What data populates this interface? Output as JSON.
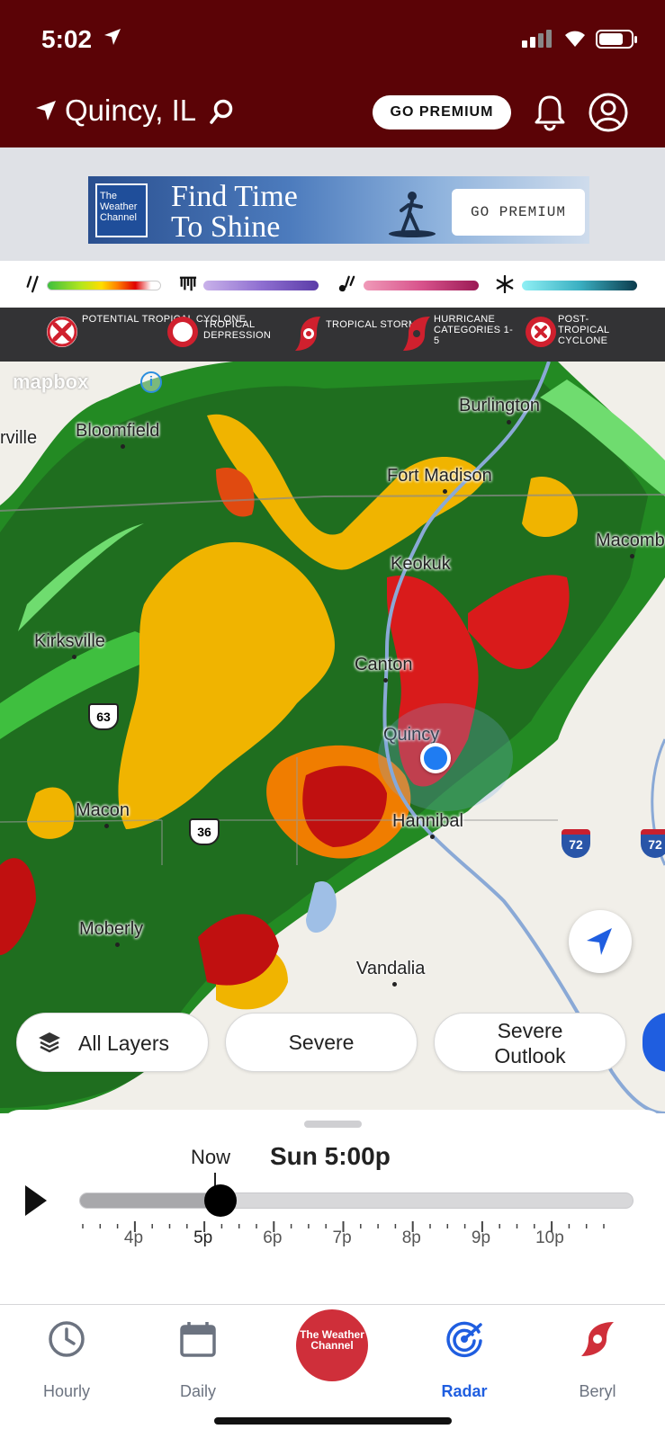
{
  "status": {
    "time": "5:02"
  },
  "header": {
    "location": "Quincy, IL",
    "premium_label": "GO PREMIUM"
  },
  "ad": {
    "logo_text": "The Weather Channel",
    "headline_line1": "Find Time",
    "headline_line2": "To Shine",
    "button_label": "GO PREMIUM"
  },
  "precip_legend": [
    {
      "type": "rain-icon",
      "colors": [
        "#3fbf3f",
        "#b5e61d",
        "#ffdd00",
        "#ff7f00",
        "#e00000",
        "#ffffff"
      ]
    },
    {
      "type": "ice-icon",
      "colors": [
        "#c9b2ea",
        "#8f6fd1",
        "#5b3ca8"
      ]
    },
    {
      "type": "mix-icon",
      "colors": [
        "#f09ab8",
        "#d8538c",
        "#9b1a55"
      ]
    },
    {
      "type": "snow-icon",
      "colors": [
        "#8ff0f5",
        "#3bb0c2",
        "#0b3b4c"
      ]
    }
  ],
  "storm_legend": [
    {
      "icon": "x-circle-icon",
      "label": "POTENTIAL TROPICAL CYCLONE"
    },
    {
      "icon": "ring-icon",
      "label": "TROPICAL DEPRESSION"
    },
    {
      "icon": "tropical-storm-icon",
      "label": "TROPICAL STORM"
    },
    {
      "icon": "hurricane-icon",
      "label": "HURRICANE CATEGORIES 1-5"
    },
    {
      "icon": "x-circle-icon",
      "label": "POST-TROPICAL CYCLONE"
    }
  ],
  "map": {
    "attribution": "mapbox",
    "cities": {
      "burlington": "Burlington",
      "bloomfield": "Bloomfield",
      "rville": "rville",
      "fort_madison": "Fort Madison",
      "macomb": "Macomb",
      "keokuk": "Keokuk",
      "kirksville": "Kirksville",
      "canton": "Canton",
      "quincy": "Quincy",
      "macon": "Macon",
      "hannibal": "Hannibal",
      "moberly": "Moberly",
      "vandalia": "Vandalia"
    },
    "routes": {
      "us63": "63",
      "us36": "36",
      "i72a": "72",
      "i72b": "72"
    }
  },
  "layer_buttons": {
    "all_layers": "All Layers",
    "severe": "Severe",
    "severe_outlook_line1": "Severe",
    "severe_outlook_line2": "Outlook"
  },
  "timeline": {
    "now_label": "Now",
    "current_time": "Sun 5:00p",
    "progress_fraction": 0.25,
    "hours": [
      "4p",
      "5p",
      "6p",
      "7p",
      "8p",
      "9p",
      "10p"
    ]
  },
  "nav": {
    "hourly": "Hourly",
    "daily": "Daily",
    "twc_logo": "The Weather Channel",
    "radar": "Radar",
    "beryl": "Beryl"
  },
  "colors": {
    "header": "#5b0306",
    "active_nav": "#1f5ee0",
    "beryl": "#cf2f3a"
  }
}
